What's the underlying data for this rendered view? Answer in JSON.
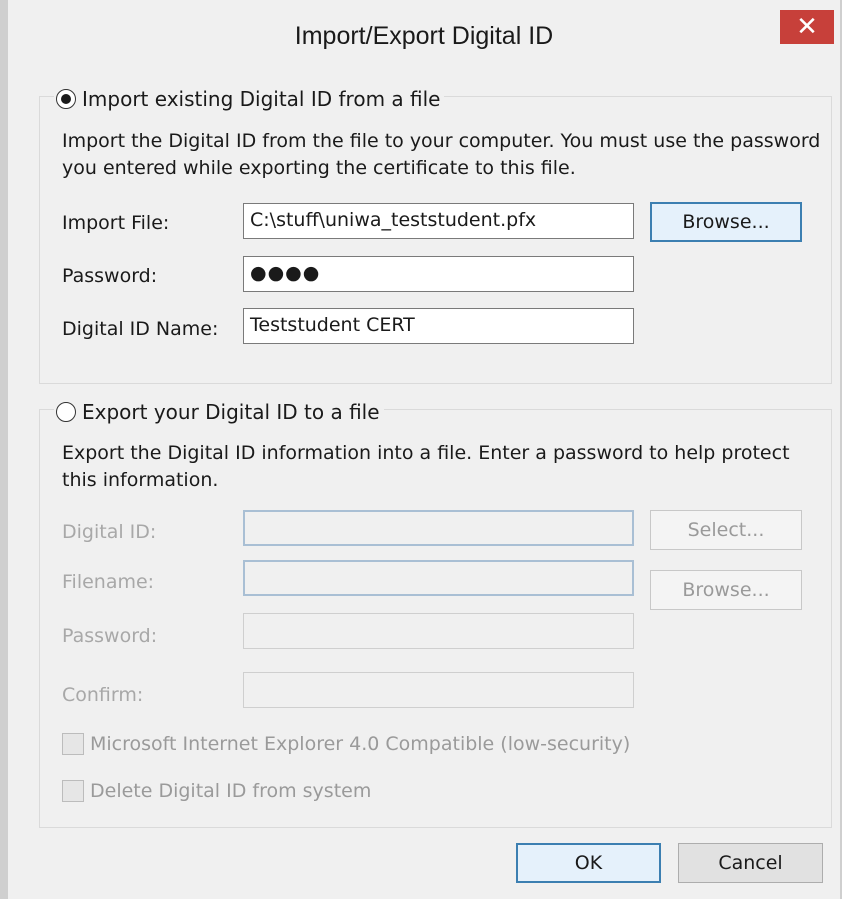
{
  "window": {
    "title": "Import/Export Digital ID",
    "close_symbol": "✕"
  },
  "import_section": {
    "radio_label": "Import existing Digital ID from a file",
    "selected": true,
    "description": "Import the Digital ID from the file to your computer. You must use the password you entered while exporting the certificate to this file.",
    "import_file_label": "Import File:",
    "import_file_value": "C:\\stuff\\uniwa_teststudent.pfx",
    "browse_label": "Browse...",
    "password_label": "Password:",
    "password_value": "●●●●",
    "digital_id_name_label": "Digital ID Name:",
    "digital_id_name_value": "Teststudent CERT"
  },
  "export_section": {
    "radio_label": "Export your Digital ID to a file",
    "selected": false,
    "description": "Export the Digital ID information into a file. Enter a password to help protect this information.",
    "digital_id_label": "Digital ID:",
    "select_label": "Select...",
    "filename_label": "Filename:",
    "browse_label": "Browse...",
    "password_label": "Password:",
    "confirm_label": "Confirm:",
    "ie_compat_label": "Microsoft Internet Explorer 4.0 Compatible (low-security)",
    "delete_label": "Delete Digital ID from system"
  },
  "footer": {
    "ok_label": "OK",
    "cancel_label": "Cancel"
  }
}
